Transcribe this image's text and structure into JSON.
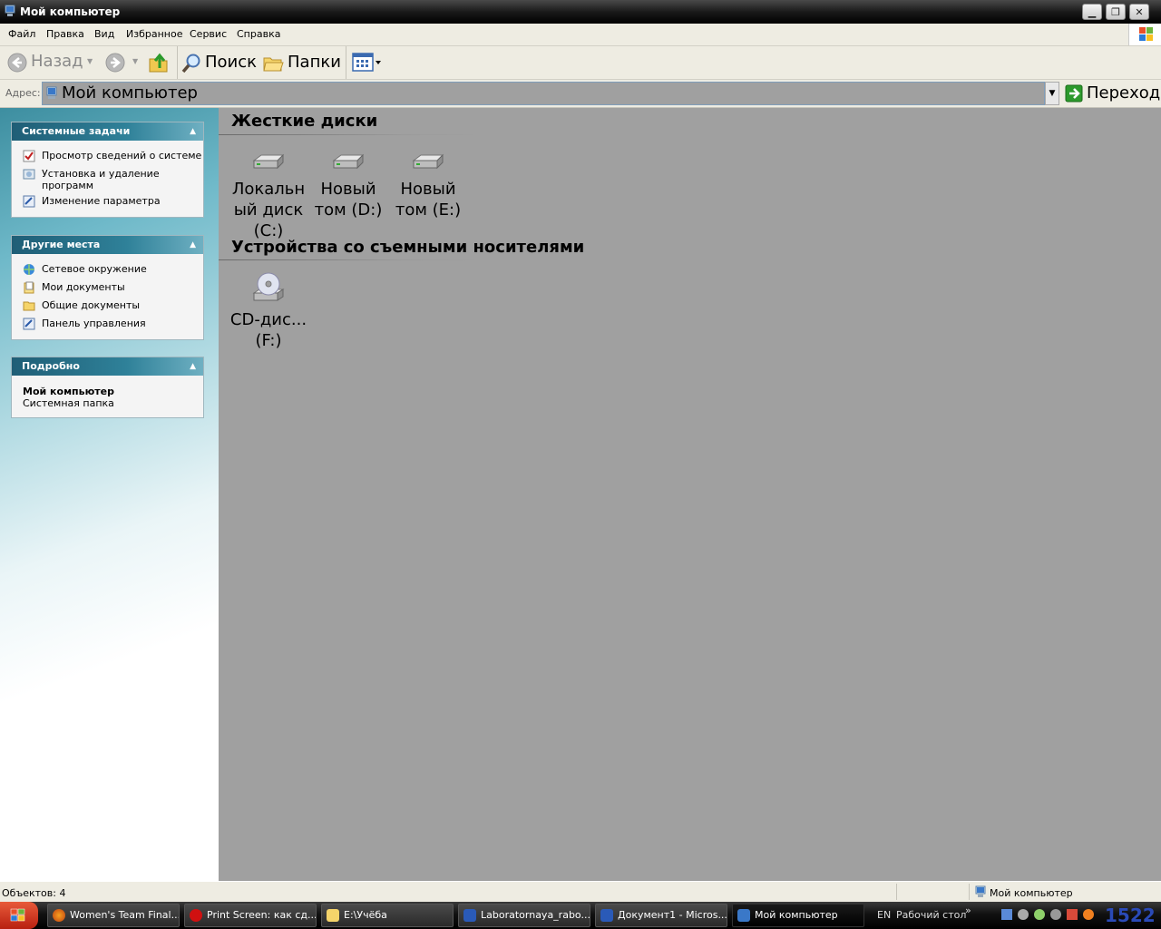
{
  "window": {
    "title": "Мой компьютер",
    "buttons": [
      "minimize",
      "restore",
      "close"
    ]
  },
  "menu": [
    "Файл",
    "Правка",
    "Вид",
    "Избранное",
    "Сервис",
    "Справка"
  ],
  "toolbar": {
    "back_label": "Назад",
    "search_label": "Поиск",
    "folders_label": "Папки"
  },
  "address": {
    "label": "Адрес:",
    "value": "Мой компьютер",
    "go_label": "Переход"
  },
  "left_panels": {
    "system_tasks": {
      "title": "Системные задачи",
      "items": [
        "Просмотр сведений о системе",
        "Установка и удаление программ",
        "Изменение параметра"
      ]
    },
    "other_places": {
      "title": "Другие места",
      "items": [
        "Сетевое окружение",
        "Мои документы",
        "Общие документы",
        "Панель управления"
      ]
    },
    "details": {
      "title": "Подробно",
      "name": "Мой компьютер",
      "type": "Системная папка"
    }
  },
  "groups": {
    "hard_disks": {
      "title": "Жесткие диски",
      "items": [
        {
          "line1": "Локальн",
          "line2": "ый диск",
          "line3": "(C:)"
        },
        {
          "line1": "Новый",
          "line2": "том (D:)"
        },
        {
          "line1": "Новый",
          "line2": "том (E:)"
        }
      ]
    },
    "removable": {
      "title": "Устройства со съемными носителями",
      "items": [
        {
          "line1": "CD-дис...",
          "line2": "(F:)"
        }
      ]
    }
  },
  "status": {
    "objects": "Объектов: 4",
    "location": "Мой компьютер"
  },
  "taskbar": {
    "items": [
      "Women's Team Final...",
      "Print Screen: как сд...",
      "E:\\Учёба",
      "Laboratornaya_rabo...",
      "Документ1 - Micros...",
      "Мой компьютер"
    ],
    "lang": "EN",
    "desktop_label": "Рабочий стол",
    "clock": "1522"
  }
}
